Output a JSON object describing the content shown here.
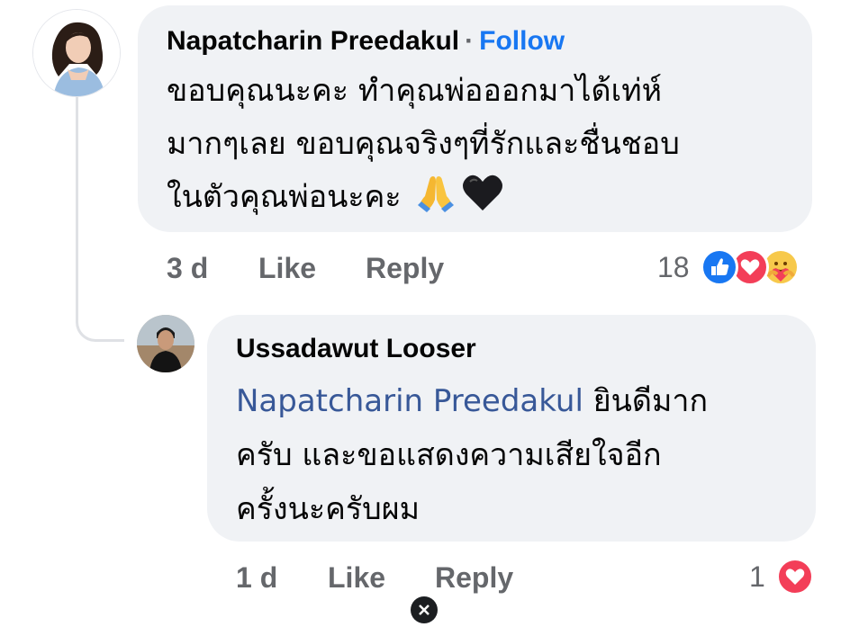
{
  "comment": {
    "author": "Napatcharin Preedakul",
    "separator": "·",
    "follow_label": "Follow",
    "text_lines": [
      "ขอบคุณนะคะ ทำคุณพ่อออกมาได้เท่ห์",
      "มากๆเลย  ขอบคุณจริงๆที่รักและชื่นชอบ",
      "ในตัวคุณพ่อนะคะ"
    ],
    "emojis": [
      "folded-hands-icon",
      "black-heart-icon"
    ],
    "time": "3 d",
    "like_label": "Like",
    "reply_label": "Reply",
    "reaction_count": "18",
    "reactions": [
      "like-reaction-icon",
      "love-reaction-icon",
      "care-reaction-icon"
    ]
  },
  "reply": {
    "author": "Ussadawut Looser",
    "mention": "Napatcharin Preedakul",
    "text_first": " ยินดีมาก",
    "text_lines": [
      "ครับ และขอแสดงความเสียใจอีก",
      "ครั้งนะครับผม"
    ],
    "time": "1 d",
    "like_label": "Like",
    "reply_label": "Reply",
    "reaction_count": "1",
    "reactions": [
      "love-reaction-icon"
    ]
  },
  "colors": {
    "bubble": "#f0f2f5",
    "link_blue": "#1877f2",
    "mention_blue": "#385898",
    "meta_gray": "#65676b",
    "love_red": "#f33e58",
    "like_blue": "#1877f2"
  }
}
